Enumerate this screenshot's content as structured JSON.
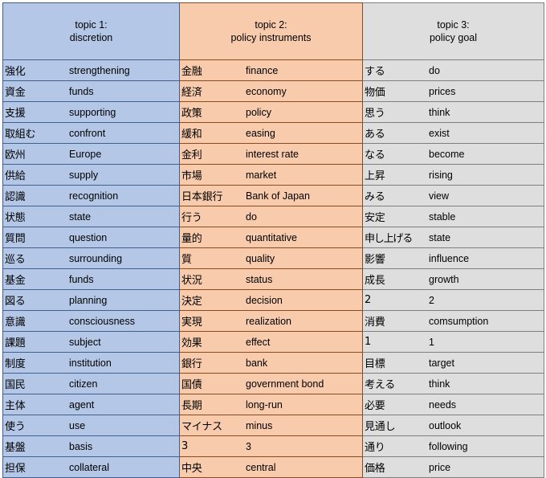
{
  "table": {
    "columns": [
      {
        "id": "topic1",
        "header_line1": "topic 1:",
        "header_line2": "discretion",
        "color": "#b4c7e7",
        "border_color": "#41608f",
        "rows": [
          {
            "jp": "強化",
            "en": "strengthening"
          },
          {
            "jp": "資金",
            "en": "funds"
          },
          {
            "jp": "支援",
            "en": "supporting"
          },
          {
            "jp": "取組む",
            "en": "confront"
          },
          {
            "jp": "欧州",
            "en": "Europe"
          },
          {
            "jp": "供給",
            "en": "supply"
          },
          {
            "jp": "認識",
            "en": "recognition"
          },
          {
            "jp": "状態",
            "en": "state"
          },
          {
            "jp": "質問",
            "en": "question"
          },
          {
            "jp": "巡る",
            "en": "surrounding"
          },
          {
            "jp": "基金",
            "en": "funds"
          },
          {
            "jp": "図る",
            "en": "planning"
          },
          {
            "jp": "意識",
            "en": "consciousness"
          },
          {
            "jp": "課題",
            "en": "subject"
          },
          {
            "jp": "制度",
            "en": "institution"
          },
          {
            "jp": "国民",
            "en": "citizen"
          },
          {
            "jp": "主体",
            "en": "agent"
          },
          {
            "jp": "使う",
            "en": "use"
          },
          {
            "jp": "基盤",
            "en": "basis"
          },
          {
            "jp": "担保",
            "en": "collateral"
          }
        ]
      },
      {
        "id": "topic2",
        "header_line1": "topic 2:",
        "header_line2": "policy instruments",
        "color": "#f8cbad",
        "border_color": "#8a4a22",
        "rows": [
          {
            "jp": "金融",
            "en": "finance"
          },
          {
            "jp": "経済",
            "en": "economy"
          },
          {
            "jp": "政策",
            "en": "policy"
          },
          {
            "jp": "緩和",
            "en": "easing"
          },
          {
            "jp": "金利",
            "en": "interest rate"
          },
          {
            "jp": "市場",
            "en": "market"
          },
          {
            "jp": "日本銀行",
            "en": "Bank of Japan"
          },
          {
            "jp": "行う",
            "en": "do"
          },
          {
            "jp": "量的",
            "en": "quantitative"
          },
          {
            "jp": "質",
            "en": "quality"
          },
          {
            "jp": "状況",
            "en": "status"
          },
          {
            "jp": "決定",
            "en": "decision"
          },
          {
            "jp": "実現",
            "en": "realization"
          },
          {
            "jp": "効果",
            "en": "effect"
          },
          {
            "jp": "銀行",
            "en": "bank"
          },
          {
            "jp": "国債",
            "en": "government bond"
          },
          {
            "jp": "長期",
            "en": "long-run"
          },
          {
            "jp": "マイナス",
            "en": "minus"
          },
          {
            "jp": "3",
            "en": "3"
          },
          {
            "jp": "中央",
            "en": "central"
          }
        ]
      },
      {
        "id": "topic3",
        "header_line1": "topic 3:",
        "header_line2": "policy goal",
        "color": "#dedede",
        "border_color": "#7f7f7f",
        "rows": [
          {
            "jp": "する",
            "en": "do"
          },
          {
            "jp": "物価",
            "en": "prices"
          },
          {
            "jp": "思う",
            "en": "think"
          },
          {
            "jp": "ある",
            "en": "exist"
          },
          {
            "jp": "なる",
            "en": "become"
          },
          {
            "jp": "上昇",
            "en": "rising"
          },
          {
            "jp": "みる",
            "en": "view"
          },
          {
            "jp": "安定",
            "en": "stable"
          },
          {
            "jp": "申し上げる",
            "en": "state"
          },
          {
            "jp": "影響",
            "en": "influence"
          },
          {
            "jp": "成長",
            "en": "growth"
          },
          {
            "jp": "2",
            "en": "2"
          },
          {
            "jp": "消費",
            "en": "comsumption"
          },
          {
            "jp": "1",
            "en": "1"
          },
          {
            "jp": "目標",
            "en": "target"
          },
          {
            "jp": "考える",
            "en": "think"
          },
          {
            "jp": "必要",
            "en": "needs"
          },
          {
            "jp": "見通し",
            "en": "outlook"
          },
          {
            "jp": "通り",
            "en": "following"
          },
          {
            "jp": "価格",
            "en": "price"
          }
        ]
      }
    ]
  }
}
